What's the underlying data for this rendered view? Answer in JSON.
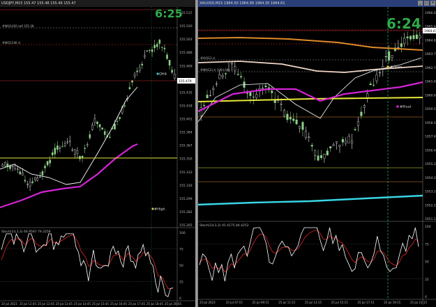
{
  "left": {
    "title": "USDJPY,M15  155.47  155.48  155.46  155.47",
    "clock": "6:25",
    "price_labels": [
      "155.537",
      "155.520",
      "155.503",
      "155.486",
      "155.469",
      "155.452",
      "155.435",
      "155.418",
      "155.401",
      "155.384",
      "155.367",
      "155.350",
      "155.333",
      "155.316",
      "155.299",
      "155.282",
      "155.265"
    ],
    "current_price": "155.479",
    "level_labels": [
      "#WtS1450 self 155.38",
      "#WtS1546 sl"
    ],
    "marker_labels": [
      "OH4",
      "#High"
    ],
    "stoch_label": "Stoch(14,3,3) 66.9597 79.3258",
    "stoch_levels": [
      "100",
      "75",
      "50",
      "25",
      "0"
    ],
    "time_labels": [
      "25 Jul 2023",
      "25 Jul 11:45",
      "25 Jul 12:45",
      "25 Jul 13:45",
      "25 Jul 14:45",
      "25 Jul 15:45",
      "25 Jul 16:45",
      "25 Jul 17:45",
      "25 Jul 18:45",
      "25 Jul 20:45"
    ]
  },
  "right": {
    "title": "XAUUSD,M15  1964.50  1964.99  1964.30  1964.61",
    "clock": "6:24",
    "price_labels": [
      "1966.09",
      "1965.60",
      "1964.80",
      "1963.75",
      "1962.70",
      "1961.65",
      "1960.60",
      "1959.55",
      "1958.50",
      "1957.45",
      "1956.40",
      "1955.35",
      "1954.30",
      "1953.25",
      "1952.20",
      "1951.15"
    ],
    "current_price": "1964.61",
    "level_labels": [
      "#HVS13 sl",
      "#WHS13 sl 1964.00"
    ],
    "marker_labels": [
      "#Open",
      "#Pivot"
    ],
    "stoch_label": "Stoch(14,3,3) 91.4175 84.4252",
    "stoch_levels": [
      "100",
      "75",
      "50",
      "25",
      "0"
    ],
    "time_labels": [
      "25 Jul 2023",
      "25 Jul 07:15",
      "25 Jul 09:15",
      "25 Jul 11:15",
      "25 Jul 13:15",
      "25 Jul 15:15",
      "25 Jul 17:15",
      "25 Jul 19:15",
      "25 Jul 21:15"
    ]
  },
  "colors": {
    "bull": "#8fd18a",
    "bear": "#e8e8e8",
    "ma_magenta": "#d424d4",
    "ma_white": "#ffffff",
    "ma_yellow": "#e8e83a",
    "ma_orange": "#e08a2a",
    "ma_cyan": "#39d6e6",
    "stoch_main": "#ffffff",
    "stoch_signal": "#cc2222",
    "clock": "#2faa4a"
  }
}
